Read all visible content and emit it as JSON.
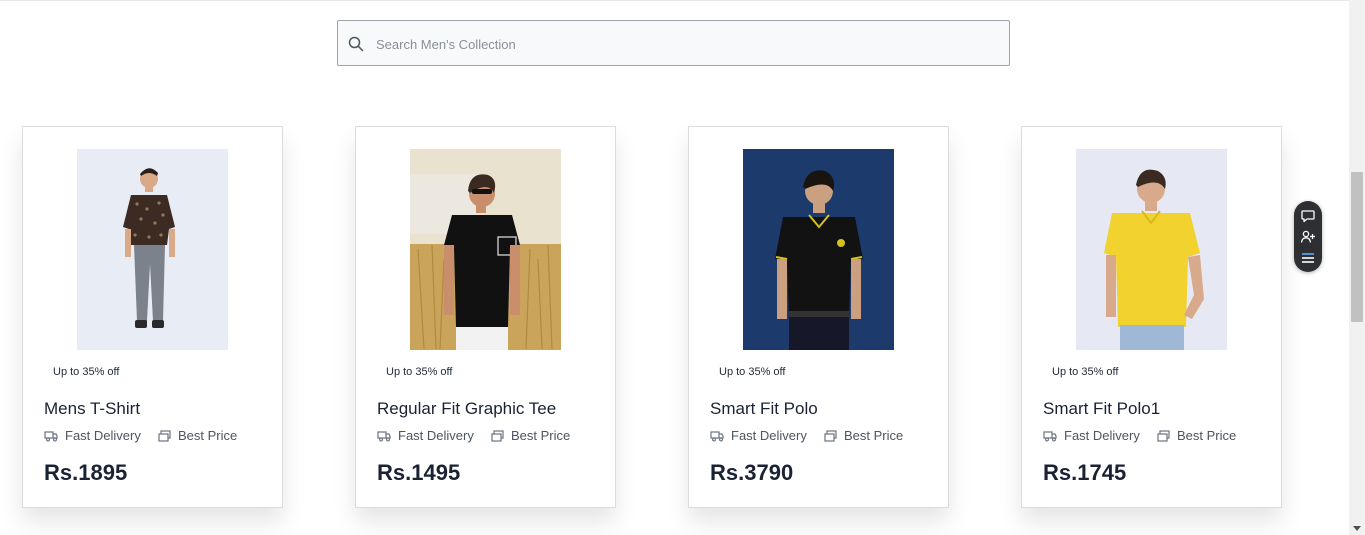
{
  "search": {
    "placeholder": "Search Men's Collection",
    "value": ""
  },
  "products": [
    {
      "badge": "Up to 35% off",
      "title": "Mens T-Shirt",
      "feature1": "Fast Delivery",
      "feature2": "Best Price",
      "price": "Rs.1895"
    },
    {
      "badge": "Up to 35% off",
      "title": "Regular Fit Graphic Tee",
      "feature1": "Fast Delivery",
      "feature2": "Best Price",
      "price": "Rs.1495"
    },
    {
      "badge": "Up to 35% off",
      "title": "Smart Fit Polo",
      "feature1": "Fast Delivery",
      "feature2": "Best Price",
      "price": "Rs.3790"
    },
    {
      "badge": "Up to 35% off",
      "title": "Smart Fit Polo1",
      "feature1": "Fast Delivery",
      "feature2": "Best Price",
      "price": "Rs.1745"
    }
  ],
  "widget": {
    "icons": [
      "chat-icon",
      "add-user-icon",
      "list-icon"
    ]
  },
  "colors": {
    "text": "#1a2233",
    "widget_bg": "#2d2f33",
    "shirt_yellow": "#f2d22e",
    "polo_bg": "#1c3a6b"
  }
}
